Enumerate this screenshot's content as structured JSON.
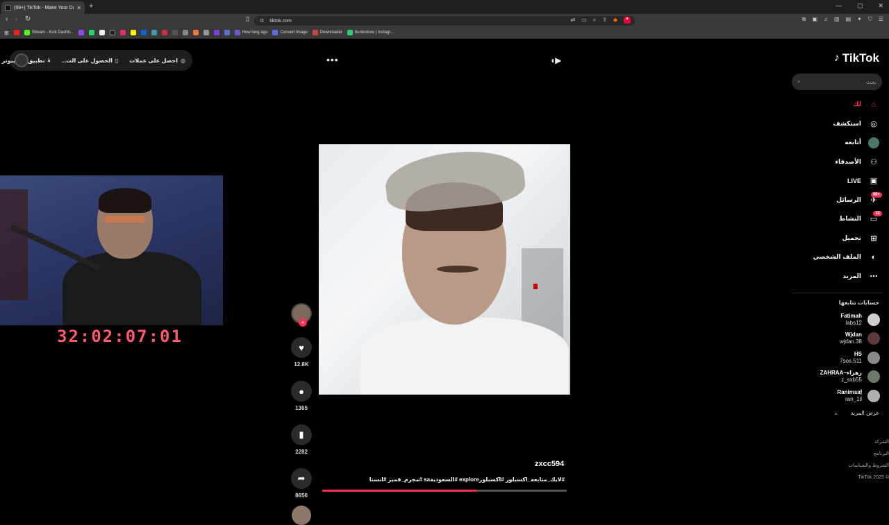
{
  "browser": {
    "tab_title": "(99+) TikTok - Make Your Day",
    "new_tab": "+",
    "url": "tiktok.com",
    "window_controls": [
      "—",
      "▢",
      "✕"
    ],
    "bookmarks": [
      {
        "label": "Stream - Kick Dashb...",
        "color": "#53fc18"
      },
      {
        "label": "How long ago",
        "color": "#6a5acd"
      },
      {
        "label": "Convert Image",
        "color": "#5b6ee1"
      },
      {
        "label": "Downloader",
        "color": "#c44"
      },
      {
        "label": "huntostore | Instagr...",
        "color": "#2ecc71"
      }
    ]
  },
  "top_bar": {
    "get_coins": "احصل على عملات",
    "get_app": "الحصول على الت...",
    "desktop_app": "تطبيق الكمبيوتر"
  },
  "stream": {
    "timer": "32:02:07:01"
  },
  "video": {
    "username": "zxcc594",
    "caption": "#لايك_متابعه_اكسبلور #اكسبلورexplore #السعوديةsa #مجرم_قميز #انستا",
    "progress": 0.63,
    "likes": "12.8K",
    "comments": "1365",
    "bookmarks": "2282",
    "shares": "8656"
  },
  "sidebar": {
    "logo": "TikTok",
    "search_placeholder": "بحث",
    "menu": [
      {
        "label": "لك",
        "icon": "home-icon",
        "active": true
      },
      {
        "label": "استكشف",
        "icon": "compass-icon"
      },
      {
        "label": "أتابعه",
        "icon": "following-avatar-icon"
      },
      {
        "label": "الأصدقاء",
        "icon": "friends-icon"
      },
      {
        "label": "LIVE",
        "icon": "live-icon"
      },
      {
        "label": "الرسائل",
        "icon": "messages-icon",
        "badge": "99+"
      },
      {
        "label": "النشاط",
        "icon": "activity-icon",
        "badge": "32"
      },
      {
        "label": "تحميل",
        "icon": "upload-icon"
      },
      {
        "label": "الملف الشخصي",
        "icon": "profile-icon"
      },
      {
        "label": "المزيد",
        "icon": "more-icon"
      }
    ],
    "following_title": "حسابات تتابعها",
    "following": [
      {
        "name": "Fatimah",
        "handle": "labs12"
      },
      {
        "name": "Wjdan",
        "handle": "wjdan.38"
      },
      {
        "name": "HS",
        "handle": "7sos.511"
      },
      {
        "name": "ZAHRAA~زهراء",
        "handle": "z_sxb55"
      },
      {
        "name": "Ranimsa🕯",
        "handle": "ran_1il"
      }
    ],
    "see_more": "عرض المزيد",
    "footer": [
      "الشركة",
      "البرنامج",
      "الشروط والسياسات",
      "© TikTok 2025"
    ]
  }
}
